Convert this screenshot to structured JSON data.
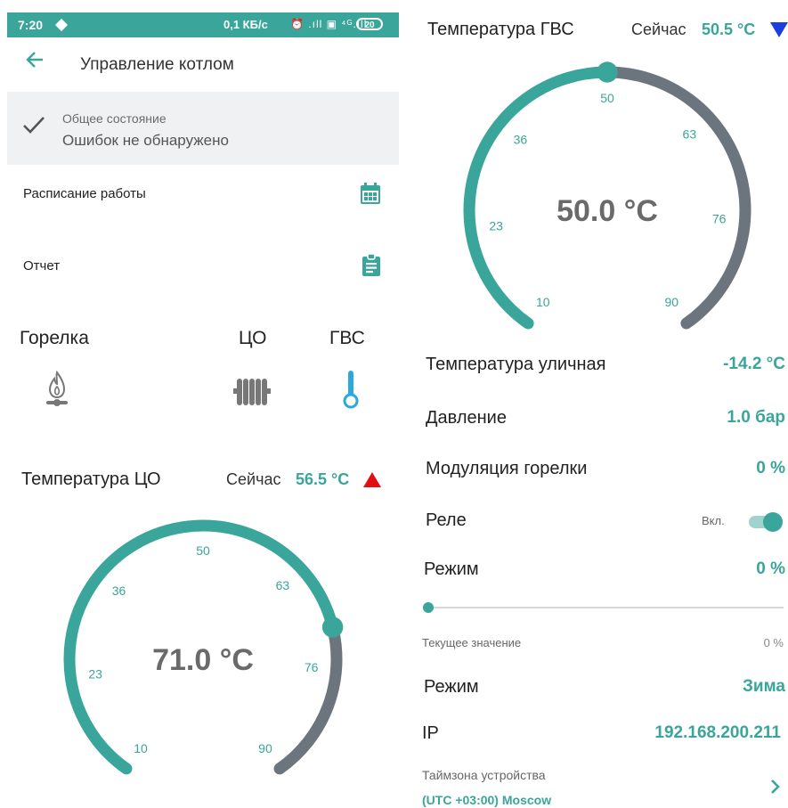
{
  "statusbar": {
    "time": "7:20",
    "net": "0,1 КБ/с",
    "icons": "⏰ .ıll ▣ ⁴ᴳ.ıll",
    "battery": "20"
  },
  "header": {
    "title": "Управление котлом"
  },
  "status": {
    "label": "Общее состояние",
    "value": "Ошибок не обнаружено"
  },
  "menu": {
    "schedule": "Расписание работы",
    "report": "Отчет"
  },
  "devices": {
    "burner": "Горелка",
    "heating": "ЦО",
    "hot_water": "ГВС"
  },
  "co": {
    "title": "Температура ЦО",
    "now_label": "Сейчас",
    "now_value": "56.5 °C",
    "setpoint": "71.0 °C",
    "setpoint_value": 71.0,
    "ticks": [
      "10",
      "23",
      "36",
      "50",
      "63",
      "76",
      "90"
    ],
    "min": 10,
    "max": 90,
    "trend": "up",
    "trend_color": "#e01010"
  },
  "gvs": {
    "title": "Температура ГВС",
    "now_label": "Сейчас",
    "now_value": "50.5 °C",
    "setpoint": "50.0 °C",
    "setpoint_value": 50.0,
    "ticks": [
      "10",
      "23",
      "36",
      "50",
      "63",
      "76",
      "90"
    ],
    "min": 10,
    "max": 90,
    "trend": "down",
    "trend_color": "#1a3fe0"
  },
  "props": {
    "outdoor_label": "Температура уличная",
    "outdoor_value": "-14.2 °C",
    "pressure_label": "Давление",
    "pressure_value": "1.0 бар",
    "modulation_label": "Модуляция горелки",
    "modulation_value": "0 %",
    "relay_label": "Реле",
    "relay_state": "Вкл.",
    "relay_on": true,
    "mode1_label": "Режим",
    "mode1_value": "0 %",
    "mode1_slider": 0,
    "current_label": "Текущее значение",
    "current_value": "0 %",
    "mode2_label": "Режим",
    "mode2_value": "Зима",
    "ip_label": "IP",
    "ip_value": "192.168.200.211",
    "tz_label": "Таймзона устройства",
    "tz_value": "(UTC +03:00) Moscow"
  },
  "colors": {
    "accent": "#3aa59a",
    "track": "#6c757d"
  }
}
